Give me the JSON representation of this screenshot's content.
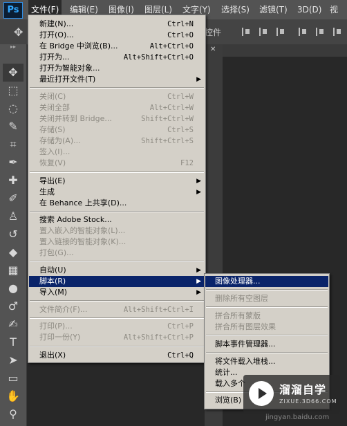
{
  "app": {
    "logo": "Ps"
  },
  "menubar": [
    {
      "label": "文件(F)",
      "active": true
    },
    {
      "label": "编辑(E)"
    },
    {
      "label": "图像(I)"
    },
    {
      "label": "图层(L)"
    },
    {
      "label": "文字(Y)"
    },
    {
      "label": "选择(S)"
    },
    {
      "label": "滤镜(T)"
    },
    {
      "label": "3D(D)"
    },
    {
      "label": "视图"
    }
  ],
  "options_bar": {
    "fragment": "控件"
  },
  "tools": [
    "move-icon",
    "marquee-icon",
    "lasso-icon",
    "quick-select-icon",
    "crop-icon",
    "eyedropper-icon",
    "healing-brush-icon",
    "brush-icon",
    "clone-stamp-icon",
    "history-brush-icon",
    "eraser-icon",
    "gradient-icon",
    "blur-icon",
    "dodge-icon",
    "pen-icon",
    "type-icon",
    "path-select-icon",
    "shape-icon",
    "hand-icon",
    "zoom-icon"
  ],
  "file_menu": {
    "items": [
      {
        "label": "新建(N)...",
        "shortcut": "Ctrl+N"
      },
      {
        "label": "打开(O)...",
        "shortcut": "Ctrl+O"
      },
      {
        "label": "在 Bridge 中浏览(B)...",
        "shortcut": "Alt+Ctrl+O"
      },
      {
        "label": "打开为...",
        "shortcut": "Alt+Shift+Ctrl+O"
      },
      {
        "label": "打开为智能对象..."
      },
      {
        "label": "最近打开文件(T)",
        "submenu": true
      },
      {
        "separator": true
      },
      {
        "label": "关闭(C)",
        "shortcut": "Ctrl+W",
        "disabled": true
      },
      {
        "label": "关闭全部",
        "shortcut": "Alt+Ctrl+W",
        "disabled": true
      },
      {
        "label": "关闭并转到 Bridge...",
        "shortcut": "Shift+Ctrl+W",
        "disabled": true
      },
      {
        "label": "存储(S)",
        "shortcut": "Ctrl+S",
        "disabled": true
      },
      {
        "label": "存储为(A)...",
        "shortcut": "Shift+Ctrl+S",
        "disabled": true
      },
      {
        "label": "签入(I)...",
        "disabled": true
      },
      {
        "label": "恢复(V)",
        "shortcut": "F12",
        "disabled": true
      },
      {
        "separator": true
      },
      {
        "label": "导出(E)",
        "submenu": true
      },
      {
        "label": "生成",
        "submenu": true
      },
      {
        "label": "在 Behance 上共享(D)..."
      },
      {
        "separator": true
      },
      {
        "label": "搜索 Adobe Stock..."
      },
      {
        "label": "置入嵌入的智能对象(L)...",
        "disabled": true
      },
      {
        "label": "置入链接的智能对象(K)...",
        "disabled": true
      },
      {
        "label": "打包(G)...",
        "disabled": true
      },
      {
        "separator": true
      },
      {
        "label": "自动(U)",
        "submenu": true
      },
      {
        "label": "脚本(R)",
        "submenu": true,
        "highlighted": true
      },
      {
        "label": "导入(M)",
        "submenu": true
      },
      {
        "separator": true
      },
      {
        "label": "文件简介(F)...",
        "shortcut": "Alt+Shift+Ctrl+I",
        "disabled": true
      },
      {
        "separator": true
      },
      {
        "label": "打印(P)...",
        "shortcut": "Ctrl+P",
        "disabled": true
      },
      {
        "label": "打印一份(Y)",
        "shortcut": "Alt+Shift+Ctrl+P",
        "disabled": true
      },
      {
        "separator": true
      },
      {
        "label": "退出(X)",
        "shortcut": "Ctrl+Q"
      }
    ]
  },
  "scripts_submenu": {
    "items": [
      {
        "label": "图像处理器...",
        "highlighted": true
      },
      {
        "separator": true
      },
      {
        "label": "删除所有空图层",
        "disabled": true
      },
      {
        "separator": true
      },
      {
        "label": "拼合所有蒙版",
        "disabled": true
      },
      {
        "label": "拼合所有图层效果",
        "disabled": true
      },
      {
        "separator": true
      },
      {
        "label": "脚本事件管理器..."
      },
      {
        "separator": true
      },
      {
        "label": "将文件载入堆栈..."
      },
      {
        "label": "统计..."
      },
      {
        "label": "载入多个"
      },
      {
        "separator": true
      },
      {
        "label": "浏览(B)"
      }
    ]
  },
  "watermark": {
    "brand": "溜溜自学",
    "domain": "ZIXUE.3D66.COM",
    "url": "jingyan.baidu.com"
  }
}
